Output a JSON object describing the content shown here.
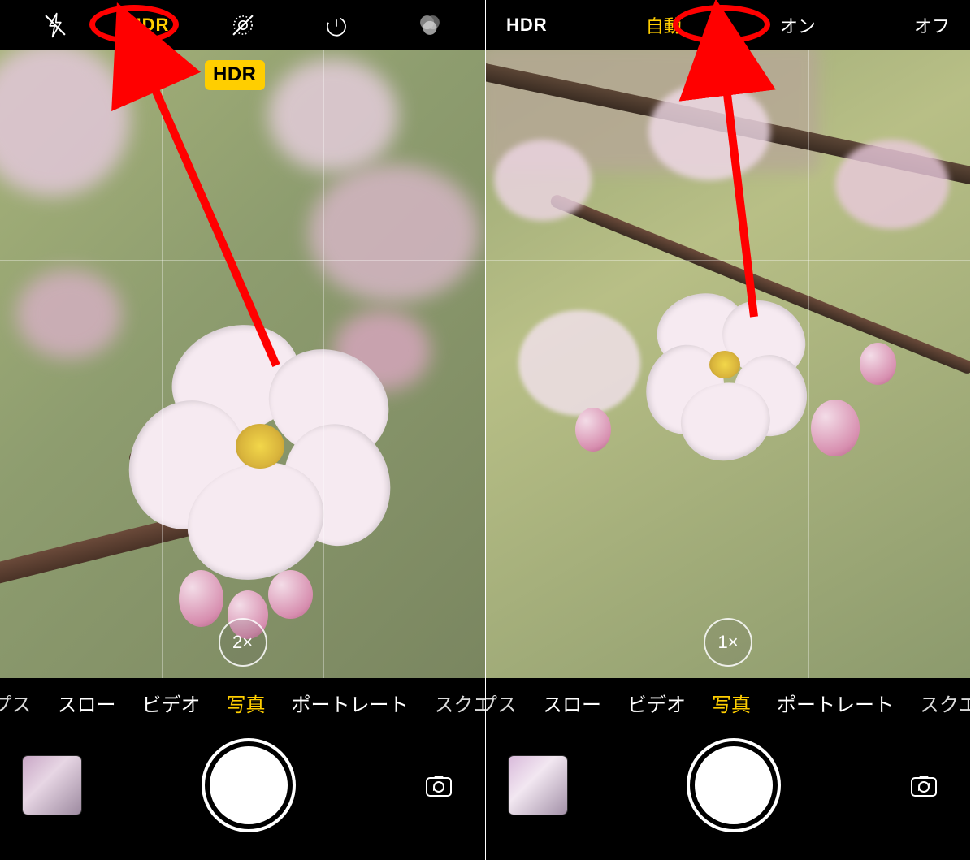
{
  "left": {
    "topbar": {
      "hdr_label": "HDR"
    },
    "hdr_badge": "HDR",
    "zoom_label": "2×",
    "modes": {
      "prev_cut": "プス",
      "slow": "スロー",
      "video": "ビデオ",
      "photo": "写真",
      "portrait": "ポートレート",
      "next_cut": "スクエ"
    }
  },
  "right": {
    "hdrbar": {
      "title": "HDR",
      "auto": "自動",
      "on": "オン",
      "off": "オフ"
    },
    "zoom_label": "1×",
    "modes": {
      "prev_cut": "プス",
      "slow": "スロー",
      "video": "ビデオ",
      "photo": "写真",
      "portrait": "ポートレート",
      "next_cut": "スクエ"
    }
  }
}
